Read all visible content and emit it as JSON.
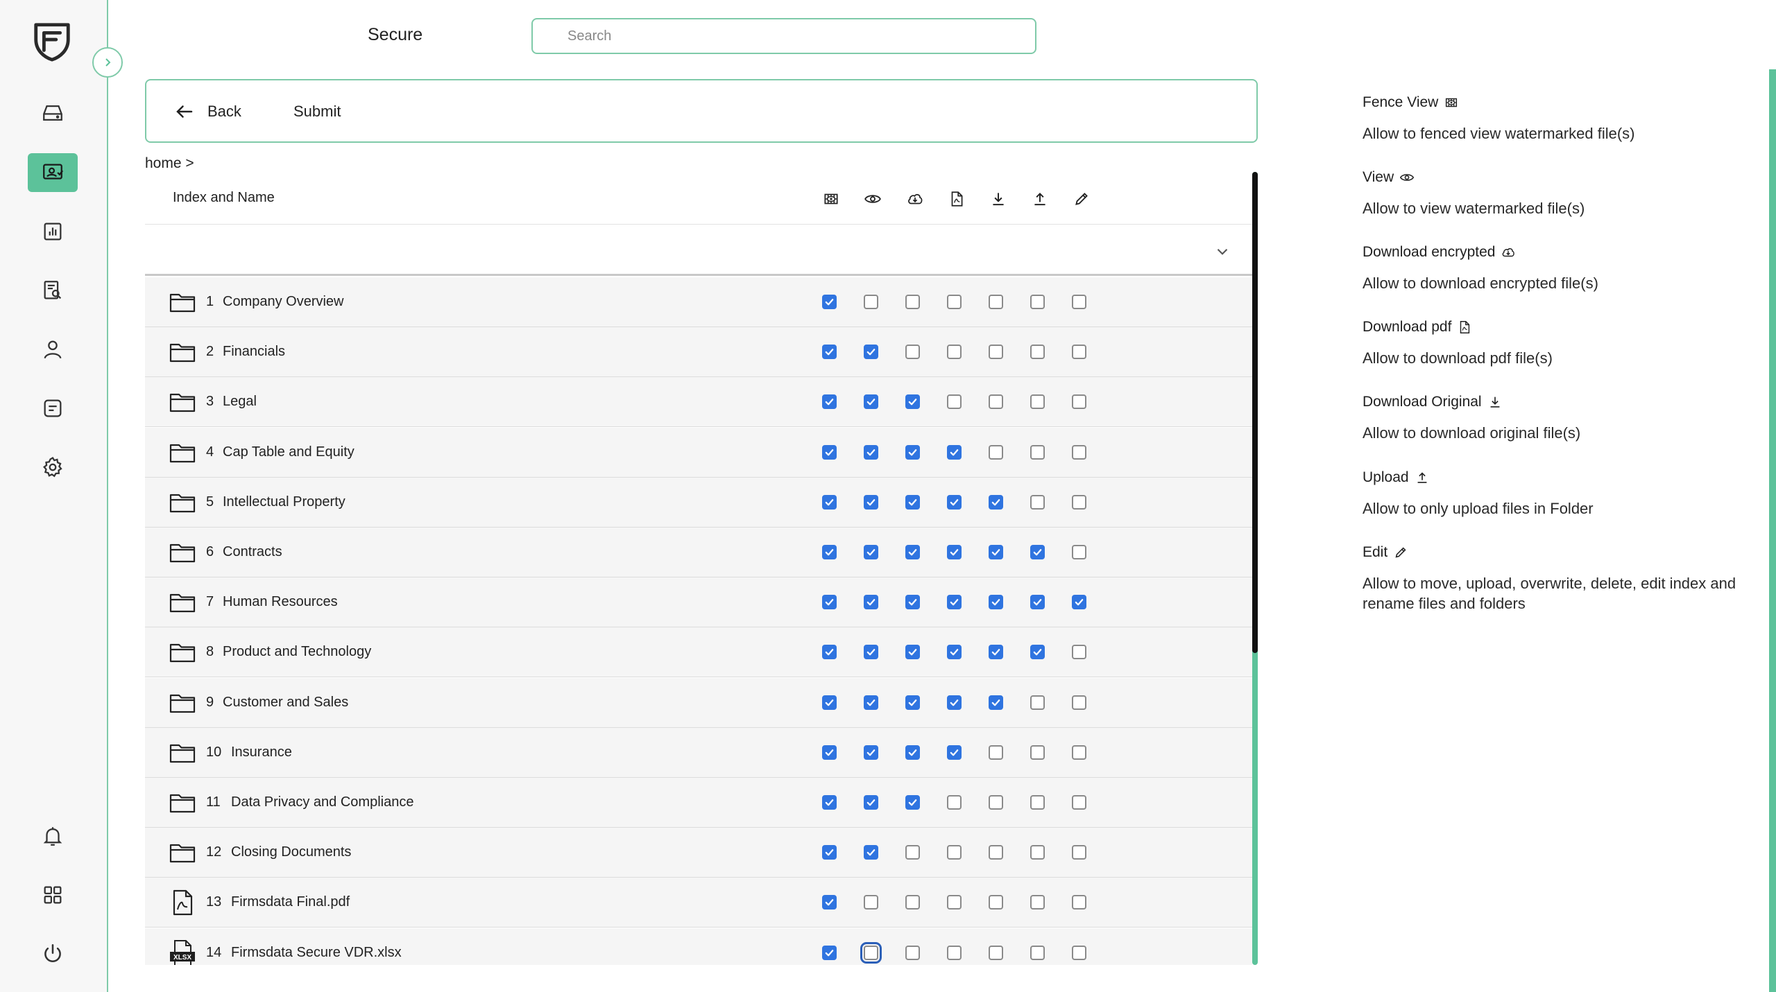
{
  "header": {
    "title": "Secure",
    "search_placeholder": "Search"
  },
  "actions": {
    "back_label": "Back",
    "submit_label": "Submit"
  },
  "breadcrumb": "home >",
  "table": {
    "name_header": "Index and Name",
    "permission_columns": [
      {
        "key": "fence_view",
        "icon": "fence-view-icon"
      },
      {
        "key": "view",
        "icon": "eye-icon"
      },
      {
        "key": "download_encrypted",
        "icon": "cloud-download-icon"
      },
      {
        "key": "download_pdf",
        "icon": "pdf-file-icon"
      },
      {
        "key": "download_original",
        "icon": "download-icon"
      },
      {
        "key": "upload",
        "icon": "upload-icon"
      },
      {
        "key": "edit",
        "icon": "pencil-icon"
      }
    ],
    "rows": [
      {
        "index": "1",
        "name": "Company Overview",
        "type": "folder",
        "perms": [
          true,
          false,
          false,
          false,
          false,
          false,
          false
        ]
      },
      {
        "index": "2",
        "name": "Financials",
        "type": "folder",
        "perms": [
          true,
          true,
          false,
          false,
          false,
          false,
          false
        ]
      },
      {
        "index": "3",
        "name": "Legal",
        "type": "folder",
        "perms": [
          true,
          true,
          true,
          false,
          false,
          false,
          false
        ]
      },
      {
        "index": "4",
        "name": "Cap Table and Equity",
        "type": "folder",
        "perms": [
          true,
          true,
          true,
          true,
          false,
          false,
          false
        ]
      },
      {
        "index": "5",
        "name": "Intellectual Property",
        "type": "folder",
        "perms": [
          true,
          true,
          true,
          true,
          true,
          false,
          false
        ]
      },
      {
        "index": "6",
        "name": "Contracts",
        "type": "folder",
        "perms": [
          true,
          true,
          true,
          true,
          true,
          true,
          false
        ]
      },
      {
        "index": "7",
        "name": "Human Resources",
        "type": "folder",
        "perms": [
          true,
          true,
          true,
          true,
          true,
          true,
          true
        ]
      },
      {
        "index": "8",
        "name": "Product and Technology",
        "type": "folder",
        "perms": [
          true,
          true,
          true,
          true,
          true,
          true,
          false
        ]
      },
      {
        "index": "9",
        "name": "Customer and Sales",
        "type": "folder",
        "perms": [
          true,
          true,
          true,
          true,
          true,
          false,
          false
        ]
      },
      {
        "index": "10",
        "name": "Insurance",
        "type": "folder",
        "perms": [
          true,
          true,
          true,
          true,
          false,
          false,
          false
        ]
      },
      {
        "index": "11",
        "name": "Data Privacy and Compliance",
        "type": "folder",
        "perms": [
          true,
          true,
          true,
          false,
          false,
          false,
          false
        ]
      },
      {
        "index": "12",
        "name": "Closing Documents",
        "type": "folder",
        "perms": [
          true,
          true,
          false,
          false,
          false,
          false,
          false
        ]
      },
      {
        "index": "13",
        "name": "Firmsdata Final.pdf",
        "type": "pdf",
        "perms": [
          true,
          false,
          false,
          false,
          false,
          false,
          false
        ]
      },
      {
        "index": "14",
        "name": "Firmsdata Secure VDR.xlsx",
        "type": "xlsx",
        "icon_text": "XLSX",
        "perms": [
          true,
          false,
          false,
          false,
          false,
          false,
          false
        ],
        "focused_col": 1
      }
    ]
  },
  "legend": [
    {
      "title": "Fence View",
      "icon": "fence-view-icon",
      "desc": "Allow to fenced view watermarked file(s)"
    },
    {
      "title": "View",
      "icon": "eye-icon",
      "desc": "Allow to view watermarked file(s)"
    },
    {
      "title": "Download encrypted",
      "icon": "cloud-download-icon",
      "desc": "Allow to download encrypted file(s)"
    },
    {
      "title": "Download pdf",
      "icon": "pdf-file-icon",
      "desc": "Allow to download pdf file(s)"
    },
    {
      "title": "Download Original",
      "icon": "download-icon",
      "desc": "Allow to download original file(s)"
    },
    {
      "title": "Upload",
      "icon": "upload-icon",
      "desc": "Allow to only upload files in Folder"
    },
    {
      "title": "Edit",
      "icon": "pencil-icon",
      "desc": "Allow to move, upload, overwrite, delete, edit index and rename files and folders"
    }
  ],
  "colors": {
    "accent": "#5cc29a",
    "border": "#7fcaa9",
    "checkbox": "#2f74e0"
  }
}
